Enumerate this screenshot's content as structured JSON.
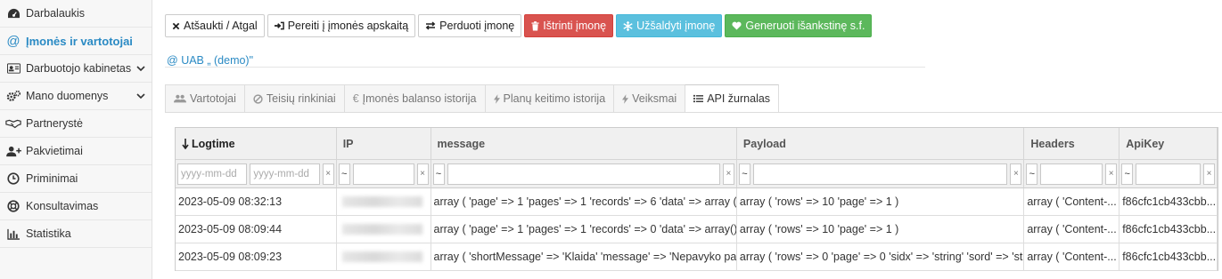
{
  "sidebar": {
    "items": [
      {
        "label": "Darbalaukis",
        "icon": "dashboard-icon"
      },
      {
        "label": "Įmonės ir vartotojai",
        "icon": "at-icon",
        "active": true
      },
      {
        "label": "Darbuotojo kabinetas",
        "icon": "id-card-icon",
        "has_submenu": true
      },
      {
        "label": "Mano duomenys",
        "icon": "cogs-icon",
        "has_submenu": true
      },
      {
        "label": "Partnerystė",
        "icon": "handshake-icon"
      },
      {
        "label": "Pakvietimai",
        "icon": "user-plus-icon"
      },
      {
        "label": "Priminimai",
        "icon": "clock-icon"
      },
      {
        "label": "Konsultavimas",
        "icon": "life-ring-icon"
      },
      {
        "label": "Statistika",
        "icon": "bar-chart-icon"
      }
    ]
  },
  "toolbar": {
    "cancel_label": "Atšaukti / Atgal",
    "goto_label": "Pereiti į įmonės apskaitą",
    "transfer_label": "Perduoti įmonę",
    "delete_label": "Ištrinti įmonę",
    "freeze_label": "Užšaldyti įmonę",
    "invoice_label": "Generuoti išankstinę s.f."
  },
  "company": {
    "name": "UAB „ (demo)\""
  },
  "tabs": [
    {
      "label": "Vartotojai",
      "icon": "users-icon"
    },
    {
      "label": "Teisių rinkiniai",
      "icon": "ban-icon"
    },
    {
      "label": "Įmonės balanso istorija",
      "icon": "euro-icon"
    },
    {
      "label": "Planų keitimo istorija",
      "icon": "bolt-icon"
    },
    {
      "label": "Veiksmai",
      "icon": "bolt-icon"
    },
    {
      "label": "API žurnalas",
      "icon": "list-icon",
      "active": true
    }
  ],
  "grid": {
    "columns": [
      "Logtime",
      "IP",
      "message",
      "Payload",
      "Headers",
      "ApiKey"
    ],
    "sorted_column": "Logtime",
    "sort_direction": "desc",
    "filters": {
      "date_from_placeholder": "yyyy-mm-dd",
      "date_to_placeholder": "yyyy-mm-dd",
      "operator": "~",
      "clear": "×"
    },
    "rows": [
      {
        "logtime": "2023-05-09 08:32:13",
        "message": "array ( 'page' => 1 'pages' => 1 'records' => 6 'data' => array ( ...",
        "payload": "array ( 'rows' => 10 'page' => 1 )",
        "headers": "array ( 'Content-...",
        "apikey": "f86cfc1cb433cbb..."
      },
      {
        "logtime": "2023-05-09 08:09:44",
        "message": "array ( 'page' => 1 'pages' => 1 'records' => 0 'data' => array()...",
        "payload": "array ( 'rows' => 10 'page' => 1 )",
        "headers": "array ( 'Content-...",
        "apikey": "f86cfc1cb433cbb..."
      },
      {
        "logtime": "2023-05-09 08:09:23",
        "message": "array ( 'shortMessage' => 'Klaida' 'message' => 'Nepavyko pa...",
        "payload": "array ( 'rows' => 0 'page' => 0 'sidx' => 'string' 'sord' => 'st...",
        "headers": "array ( 'Content-...",
        "apikey": "f86cfc1cb433cbb..."
      }
    ]
  }
}
